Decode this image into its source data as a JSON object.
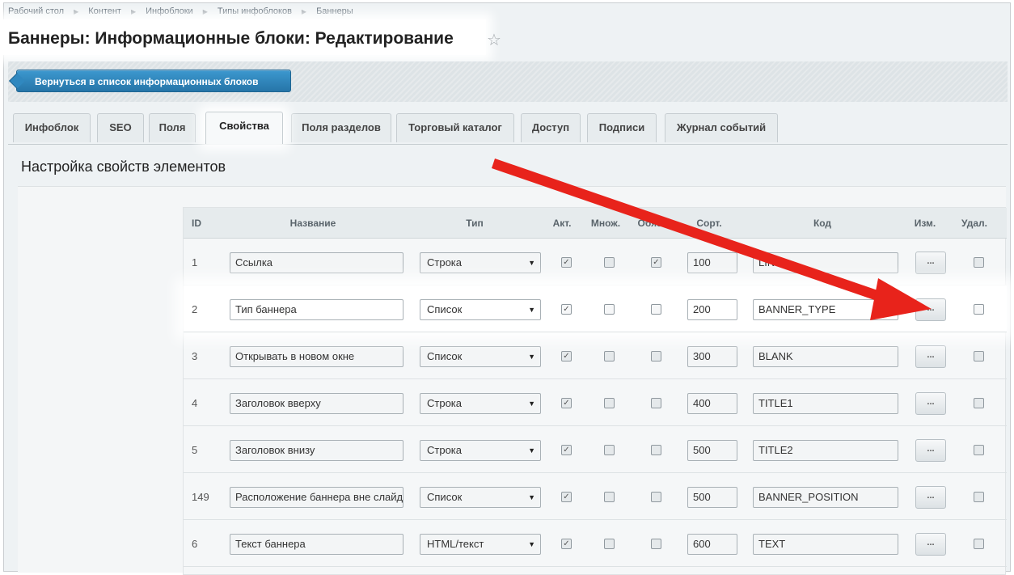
{
  "breadcrumb": [
    "Рабочий стол",
    "Контент",
    "Инфоблоки",
    "Типы инфоблоков",
    "Баннеры"
  ],
  "page_title": "Баннеры: Информационные блоки: Редактирование",
  "back_button": "Вернуться в список информационных блоков",
  "tabs": [
    "Инфоблок",
    "SEO",
    "Поля",
    "Свойства",
    "Поля разделов",
    "Торговый каталог",
    "Доступ",
    "Подписи",
    "Журнал событий"
  ],
  "active_tab": "Свойства",
  "section_title": "Настройка свойств элементов",
  "columns": [
    "ID",
    "Название",
    "Тип",
    "Акт.",
    "Множ.",
    "Обяз.",
    "Сорт.",
    "Код",
    "Изм.",
    "Удал."
  ],
  "edit_button_label": "...",
  "check_mark": "✓",
  "colors": {
    "accent_button": "#2e86c1",
    "arrow": "#e8231b"
  },
  "rows": [
    {
      "id": "1",
      "name": "Ссылка",
      "type": "Строка",
      "active": true,
      "multiple": false,
      "required": true,
      "sort": "100",
      "code": "LINK",
      "delete": false
    },
    {
      "id": "2",
      "name": "Тип баннера",
      "type": "Список",
      "active": true,
      "multiple": false,
      "required": false,
      "sort": "200",
      "code": "BANNER_TYPE",
      "delete": false
    },
    {
      "id": "3",
      "name": "Открывать в новом окне",
      "type": "Список",
      "active": true,
      "multiple": false,
      "required": false,
      "sort": "300",
      "code": "BLANK",
      "delete": false
    },
    {
      "id": "4",
      "name": "Заголовок вверху",
      "type": "Строка",
      "active": true,
      "multiple": false,
      "required": false,
      "sort": "400",
      "code": "TITLE1",
      "delete": false
    },
    {
      "id": "5",
      "name": "Заголовок внизу",
      "type": "Строка",
      "active": true,
      "multiple": false,
      "required": false,
      "sort": "500",
      "code": "TITLE2",
      "delete": false
    },
    {
      "id": "149",
      "name": "Расположение баннера вне слайд",
      "type": "Список",
      "active": true,
      "multiple": false,
      "required": false,
      "sort": "500",
      "code": "BANNER_POSITION",
      "delete": false
    },
    {
      "id": "6",
      "name": "Текст баннера",
      "type": "HTML/текст",
      "active": true,
      "multiple": false,
      "required": false,
      "sort": "600",
      "code": "TEXT",
      "delete": false
    }
  ]
}
